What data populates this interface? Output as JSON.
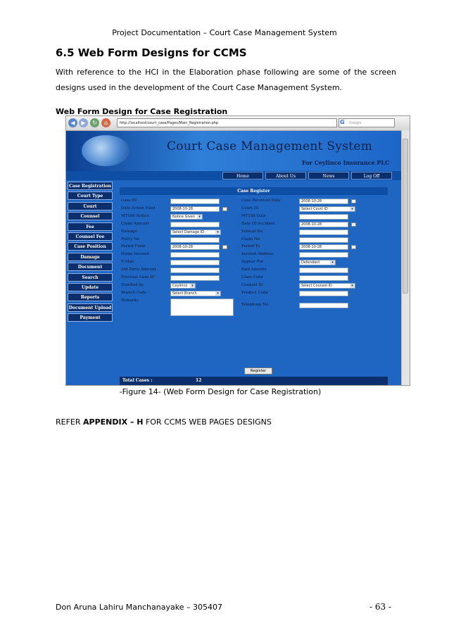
{
  "doc": {
    "header": "Project Documentation – Court Case Management System",
    "section_title": "6.5 Web Form Designs for CCMS",
    "paragraph": "With reference to the HCI in the Elaboration phase following are some of the screen designs used in the development of the Court Case Management System.",
    "subheading": "Web Form Design for Case Registration",
    "caption": "-Figure 14- (Web Form Design for Case Registration)",
    "refer_prefix": "REFER ",
    "refer_bold": "APPENDIX – H",
    "refer_suffix": " FOR CCMS WEB PAGES DESIGNS",
    "footer_left": "Don Aruna Lahiru Manchanayake – 305407",
    "footer_right": "- 63 -"
  },
  "browser": {
    "url": "http://localhost/court_case/Pages/Main_Registration.php",
    "search_placeholder": "Google"
  },
  "site": {
    "title": "Court Case Management System",
    "subtitle": "For Ceylinco Insurance PLC",
    "nav": [
      "Home",
      "About Us",
      "News",
      "Log Off"
    ],
    "sidebar": [
      "Case Registration",
      "Court Type",
      "Court",
      "Counsel",
      "Fee",
      "Counsel Fee",
      "Case Position",
      "Damage",
      "Document",
      "Search",
      "Update",
      "Reports",
      "Document Upload",
      "Payment"
    ],
    "form_title": "Case Register",
    "left_fields": [
      {
        "label": "Case ID",
        "value": ""
      },
      {
        "label": "Date Action Filed",
        "value": "2008-10-28"
      },
      {
        "label": "MT106 Notice",
        "value": "Notice Given"
      },
      {
        "label": "Claim Amount",
        "value": ""
      },
      {
        "label": "Damage",
        "value": "Select Damage ID"
      },
      {
        "label": "Policy No",
        "value": ""
      },
      {
        "label": "Period From",
        "value": "2008-10-28"
      },
      {
        "label": "Name Insured",
        "value": ""
      },
      {
        "label": "E-Mail",
        "value": ""
      },
      {
        "label": "3rd Party Amount",
        "value": ""
      },
      {
        "label": "Previous Case ID",
        "value": ""
      },
      {
        "label": "Handled by",
        "value": "Ceylinco"
      },
      {
        "label": "Branch Code",
        "value": "Select Branch"
      },
      {
        "label": "Remarks",
        "value": ""
      }
    ],
    "right_fields": [
      {
        "label": "Case Received Date",
        "value": "2008-10-28"
      },
      {
        "label": "Court ID",
        "value": "Select Court ID"
      },
      {
        "label": "MT106 Date",
        "value": ""
      },
      {
        "label": "Date Of Accident",
        "value": "2008-10-28"
      },
      {
        "label": "Vehical No",
        "value": ""
      },
      {
        "label": "Claim No",
        "value": ""
      },
      {
        "label": "Period To",
        "value": "2008-10-28"
      },
      {
        "label": "Insured Address",
        "value": ""
      },
      {
        "label": "Appear For",
        "value": "Defendant"
      },
      {
        "label": "Paid Amount",
        "value": ""
      },
      {
        "label": "Class Code",
        "value": ""
      },
      {
        "label": "Counsel ID",
        "value": "Select Counsel ID"
      },
      {
        "label": "Product Code",
        "value": ""
      },
      {
        "label": "Telephone No",
        "value": ""
      }
    ],
    "register_button": "Register",
    "total_label": "Total Cases :",
    "total_value": "12"
  }
}
